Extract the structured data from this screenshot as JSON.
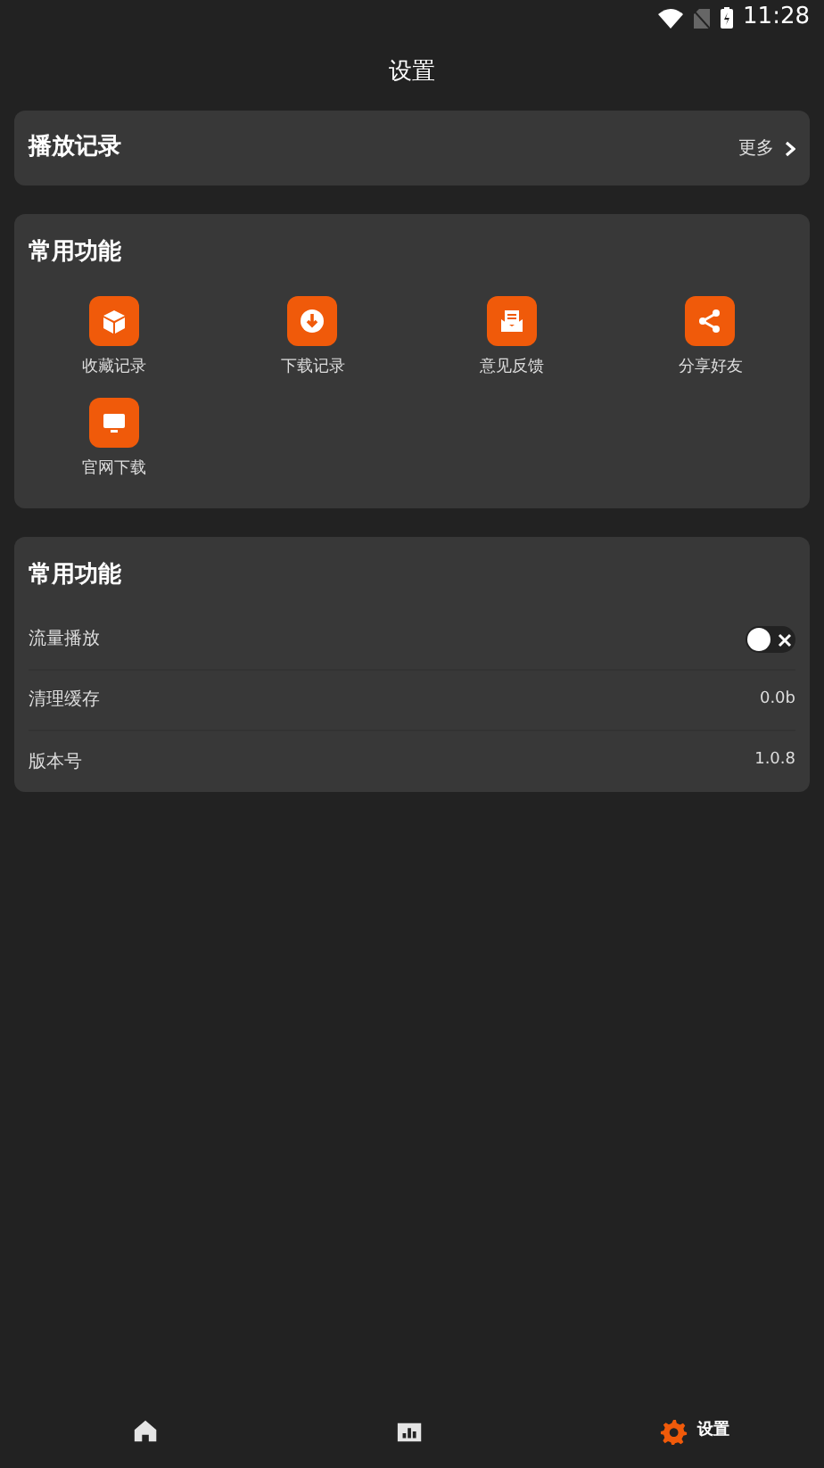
{
  "status_bar": {
    "time": "11:28"
  },
  "header": {
    "title": "设置"
  },
  "history": {
    "title": "播放记录",
    "more": "更多"
  },
  "features": {
    "title": "常用功能",
    "items": [
      {
        "label": "收藏记录",
        "kind": "cube"
      },
      {
        "label": "下载记录",
        "kind": "download"
      },
      {
        "label": "意见反馈",
        "kind": "mail"
      },
      {
        "label": "分享好友",
        "kind": "share"
      },
      {
        "label": "官网下载",
        "kind": "monitor"
      }
    ]
  },
  "settings": {
    "title": "常用功能",
    "rows": [
      {
        "label": "流量播放",
        "kind": "toggle",
        "on": false
      },
      {
        "label": "清理缓存",
        "kind": "value",
        "value": "0.0b"
      },
      {
        "label": "版本号",
        "kind": "value",
        "value": "1.0.8"
      }
    ]
  },
  "bottom_nav": [
    {
      "kind": "home",
      "selected": false
    },
    {
      "kind": "chart",
      "selected": false
    },
    {
      "kind": "settings",
      "label": "设置",
      "selected": true
    }
  ]
}
